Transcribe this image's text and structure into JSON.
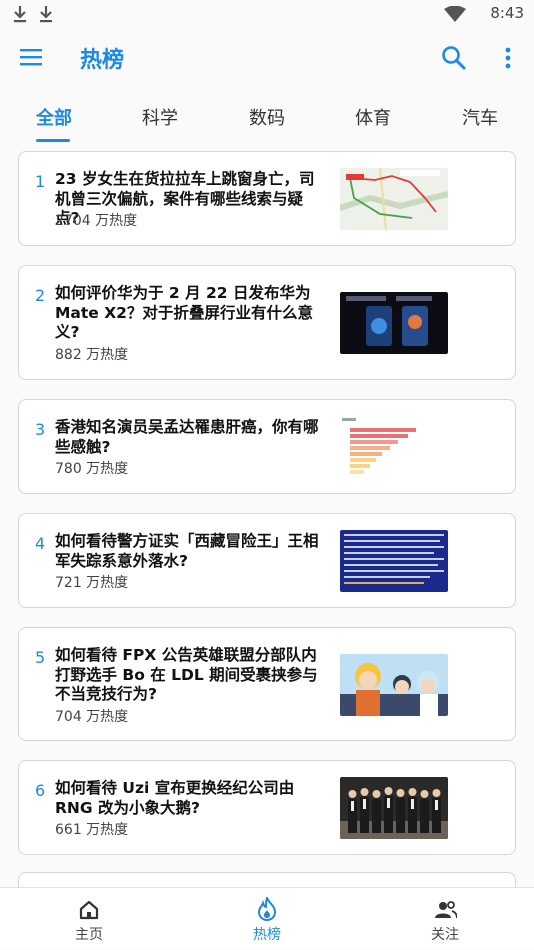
{
  "status_bar": {
    "time": "8:43",
    "icons": [
      "download-icon",
      "download-icon",
      "wifi-icon",
      "battery-icon"
    ]
  },
  "app_bar": {
    "title": "热榜",
    "icons": [
      "menu-icon",
      "search-icon",
      "more-vert-icon"
    ]
  },
  "tabs": [
    {
      "label": "全部",
      "active": true
    },
    {
      "label": "科学",
      "active": false
    },
    {
      "label": "数码",
      "active": false
    },
    {
      "label": "体育",
      "active": false
    },
    {
      "label": "汽车",
      "active": false
    }
  ],
  "items": [
    {
      "rank": "1",
      "title": "23 岁女生在货拉拉车上跳窗身亡，司机曾三次偏航，案件有哪些线索与疑点?",
      "heat": "2704 万热度",
      "thumb": "map-thumbnail"
    },
    {
      "rank": "2",
      "title": "如何评价华为于 2 月 22 日发布华为 Mate X2？对于折叠屏行业有什么意义?",
      "heat": "882 万热度",
      "thumb": "phone-thumbnail"
    },
    {
      "rank": "3",
      "title": "香港知名演员吴孟达罹患肝癌，你有哪些感触?",
      "heat": "780 万热度",
      "thumb": "chart-thumbnail"
    },
    {
      "rank": "4",
      "title": "如何看待警方证实「西藏冒险王」王相军失踪系意外落水?",
      "heat": "721 万热度",
      "thumb": "text-thumbnail"
    },
    {
      "rank": "5",
      "title": "如何看待 FPX 公告英雄联盟分部队内打野选手 Bo 在 LDL 期间受裹挟参与不当竞技行为?",
      "heat": "704 万热度",
      "thumb": "anime-thumbnail"
    },
    {
      "rank": "6",
      "title": "如何看待 Uzi 宣布更换经纪公司由 RNG 改为小象大鹅?",
      "heat": "661 万热度",
      "thumb": "group-photo-thumbnail"
    }
  ],
  "bottom_nav": [
    {
      "label": "主页",
      "icon": "home-icon",
      "active": false
    },
    {
      "label": "热榜",
      "icon": "flame-icon",
      "active": true
    },
    {
      "label": "关注",
      "icon": "people-icon",
      "active": false
    }
  ],
  "colors": {
    "accent": "#1e88e5",
    "text": "#111111",
    "muted": "#444444"
  }
}
